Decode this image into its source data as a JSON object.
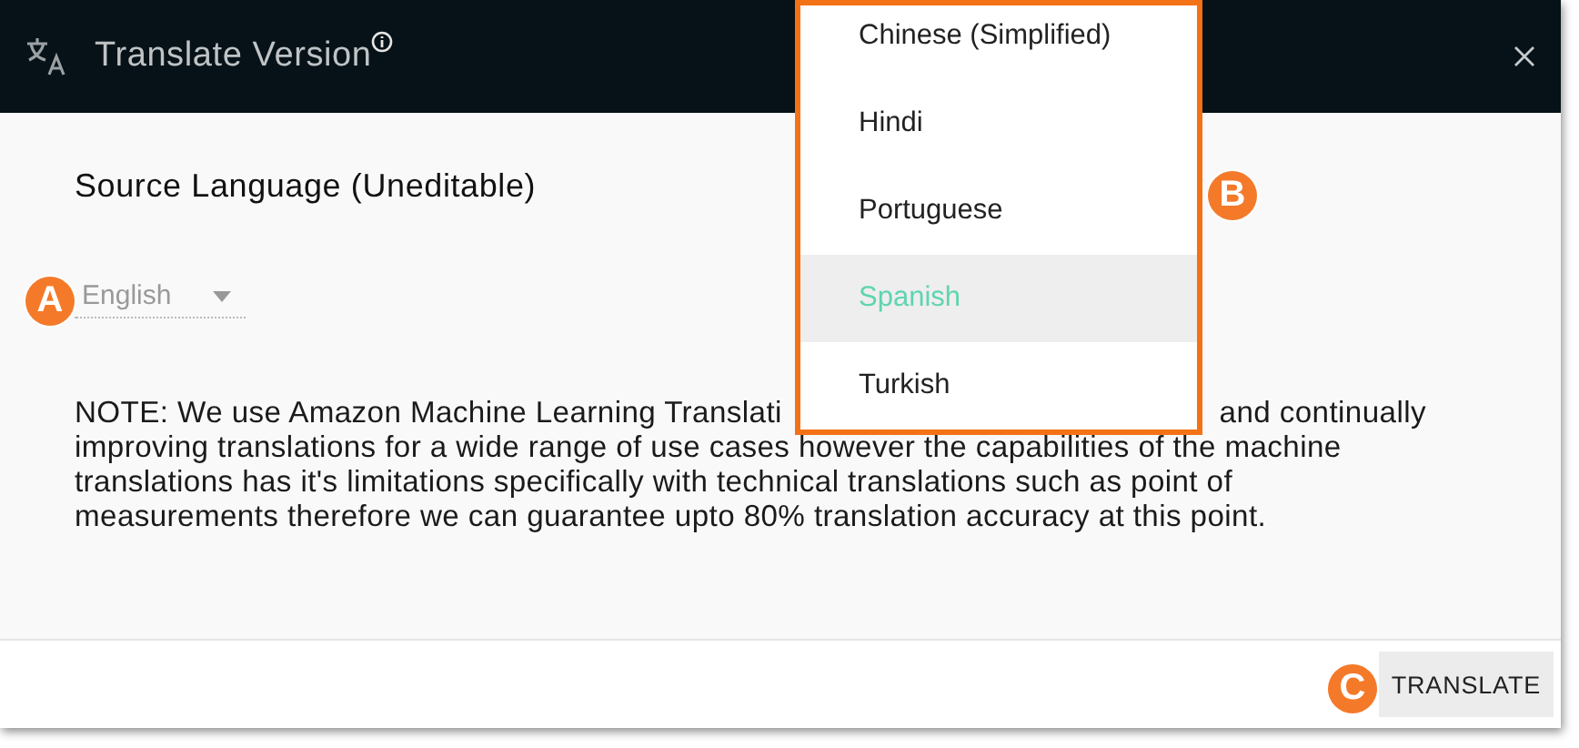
{
  "window": {
    "title": "Translate Version"
  },
  "source_language": {
    "heading": "Source Language (Uneditable)",
    "value": "English",
    "disabled": true
  },
  "note": {
    "lines": [
      [
        "NOTE: We use Amazon Machine Learning Translati",
        "and continually"
      ],
      [
        "improving translations for a wide range of use cases however the capabilities of the machine"
      ],
      [
        "translations has it's limitations specifically with technical translations such as point of"
      ],
      [
        "measurements therefore we can guarantee upto 80% translation accuracy at this point."
      ]
    ]
  },
  "dropdown": {
    "options": [
      {
        "label": "Chinese (Simplified)",
        "selected": false
      },
      {
        "label": "Hindi",
        "selected": false
      },
      {
        "label": "Portuguese",
        "selected": false
      },
      {
        "label": "Spanish",
        "selected": true
      },
      {
        "label": "Turkish",
        "selected": false
      }
    ]
  },
  "footer": {
    "button": "TRANSLATE"
  },
  "callouts": [
    {
      "label": "A"
    },
    {
      "label": "B"
    },
    {
      "label": "C"
    }
  ]
}
